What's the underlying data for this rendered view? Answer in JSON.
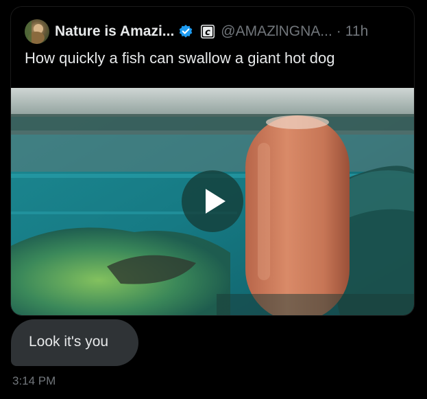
{
  "tweet": {
    "display_name": "Nature is Amazi...",
    "handle": "@AMAZlNGNA...",
    "separator": "·",
    "time_ago": "11h",
    "text": "How quickly a fish can swallow a giant hot dog",
    "media": {
      "kind": "video",
      "play_icon": "play-icon"
    },
    "icons": {
      "verified": "verified-badge-icon",
      "affiliate": "affiliate-c-icon"
    }
  },
  "message": {
    "text": "Look it's you",
    "timestamp": "3:14 PM"
  },
  "colors": {
    "background": "#000000",
    "text_primary": "#e7e9ea",
    "text_secondary": "#71767b",
    "bubble": "#2f3336",
    "verified_blue": "#1d9bf0"
  }
}
